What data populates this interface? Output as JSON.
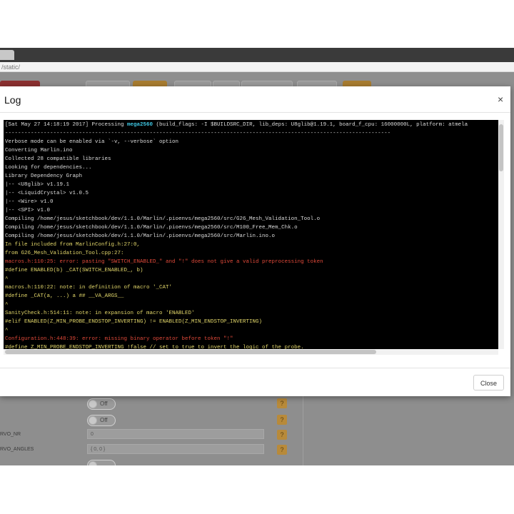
{
  "browser": {
    "url": "/static/"
  },
  "background": {
    "toggles": [
      "Off",
      "Off"
    ],
    "help_glyph": "?",
    "fields": [
      {
        "label": "RVO_NR",
        "value": "0"
      },
      {
        "label": "RVO_ANGLES",
        "value": "{ 0, 0 }"
      }
    ]
  },
  "modal": {
    "title": "Log",
    "close_glyph": "×",
    "close_button": "Close",
    "log_lines": [
      {
        "color": "w",
        "parts": [
          {
            "text": "[Sat May 27 14:18:19 2017] Processing ",
            "color": "w"
          },
          {
            "text": "mega2560",
            "color": "c"
          },
          {
            "text": " (build_flags: -I $BUILDSRC_DIR, lib_deps: U8glib@1.19.1, board_f_cpu: 16000000L, platform: atmela",
            "color": "w"
          }
        ]
      },
      {
        "color": "w",
        "text": "------------------------------------------------------------------------------------------------------------------------"
      },
      {
        "color": "w",
        "text": "Verbose mode can be enabled via `-v, --verbose` option"
      },
      {
        "color": "w",
        "text": "Converting Marlin.ino"
      },
      {
        "color": "w",
        "text": "Collected 28 compatible libraries"
      },
      {
        "color": "w",
        "text": "Looking for dependencies..."
      },
      {
        "color": "w",
        "text": "Library Dependency Graph"
      },
      {
        "color": "w",
        "text": "|-- <U8glib> v1.19.1"
      },
      {
        "color": "w",
        "text": "|-- <LiquidCrystal> v1.0.5"
      },
      {
        "color": "w",
        "text": "|-- <Wire> v1.0"
      },
      {
        "color": "w",
        "text": "|-- <SPI> v1.0"
      },
      {
        "color": "w",
        "text": "Compiling /home/jesus/sketchbook/dev/1.1.0/Marlin/.pioenvs/mega2560/src/G26_Mesh_Validation_Tool.o"
      },
      {
        "color": "w",
        "text": "Compiling /home/jesus/sketchbook/dev/1.1.0/Marlin/.pioenvs/mega2560/src/M100_Free_Mem_Chk.o"
      },
      {
        "color": "w",
        "text": "Compiling /home/jesus/sketchbook/dev/1.1.0/Marlin/.pioenvs/mega2560/src/Marlin.ino.o"
      },
      {
        "color": "y",
        "text": "In file included from MarlinConfig.h:27:0,"
      },
      {
        "color": "y",
        "text": "from G26_Mesh_Validation_Tool.cpp:27:"
      },
      {
        "color": "r",
        "text": "macros.h:110:25: error: pasting \"SWITCH_ENABLED_\" and \"!\" does not give a valid preprocessing token"
      },
      {
        "color": "y",
        "text": "#define ENABLED(b) _CAT(SWITCH_ENABLED_, b)"
      },
      {
        "color": "y",
        "text": "^"
      },
      {
        "color": "y",
        "text": "macros.h:110:22: note: in definition of macro '_CAT'"
      },
      {
        "color": "y",
        "text": "#define _CAT(a, ...) a ## __VA_ARGS__"
      },
      {
        "color": "y",
        "text": "^"
      },
      {
        "color": "y",
        "text": "SanityCheck.h:514:11: note: in expansion of macro 'ENABLED'"
      },
      {
        "color": "y",
        "text": "#elif ENABLED(Z_MIN_PROBE_ENDSTOP_INVERTING) != ENABLED(Z_MIN_ENDSTOP_INVERTING)"
      },
      {
        "color": "y",
        "text": "^"
      },
      {
        "color": "r",
        "text": "Configuration.h:448:39: error: missing binary operator before token \"!\""
      },
      {
        "color": "y",
        "text": "#define Z_MIN_PROBE_ENDSTOP_INVERTING !false // set to true to invert the logic of the probe."
      }
    ]
  }
}
